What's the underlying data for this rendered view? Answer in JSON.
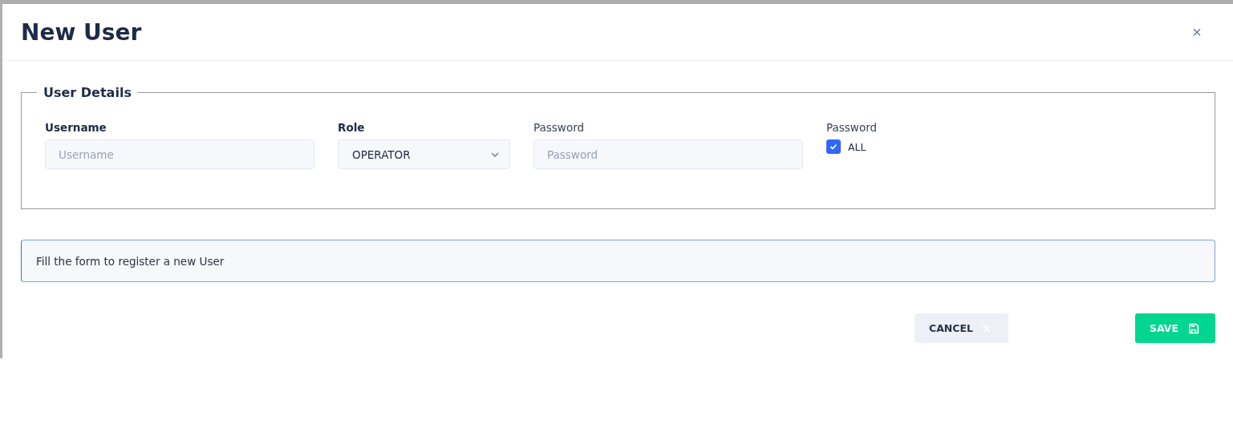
{
  "dialog": {
    "title": "New User",
    "close": "×"
  },
  "fieldset": {
    "legend": "User Details",
    "fields": [
      {
        "kind": "text",
        "label": "Username",
        "bold": true,
        "placeholder": "Username"
      },
      {
        "kind": "select",
        "label": "Role",
        "bold": true,
        "value": "OPERATOR"
      },
      {
        "kind": "password",
        "label": "Password",
        "bold": false,
        "placeholder": "Password"
      },
      {
        "kind": "checkbox",
        "label": "Password",
        "bold": false,
        "option": "ALL",
        "checked": true
      }
    ]
  },
  "info": "Fill the form to register a new User",
  "buttons": [
    {
      "kind": "cancel",
      "label": "CANCEL"
    },
    {
      "kind": "save",
      "label": "SAVE"
    }
  ]
}
